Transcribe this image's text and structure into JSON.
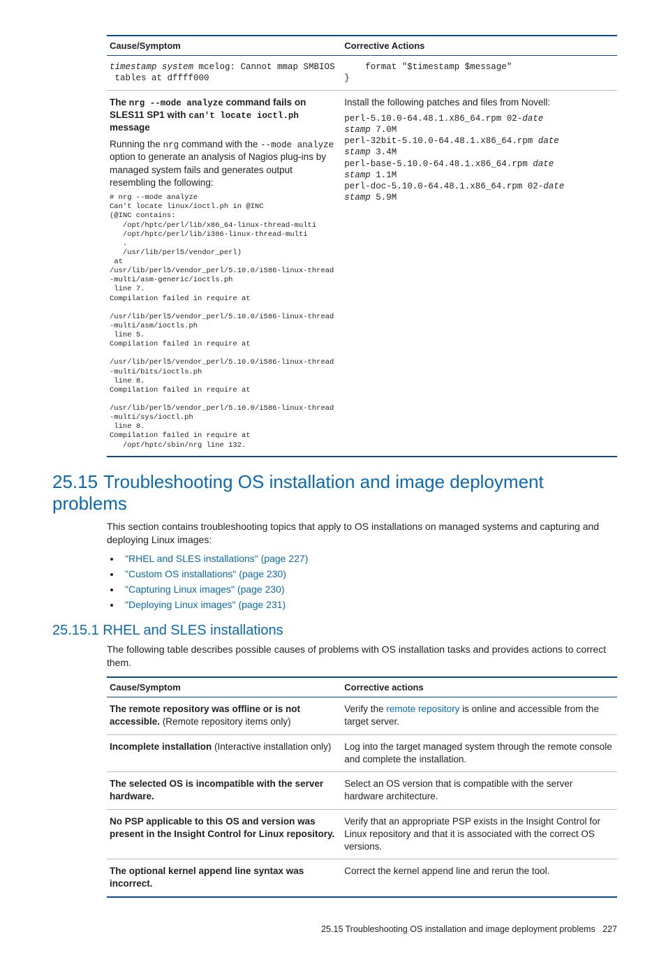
{
  "table1": {
    "headers": {
      "col1": "Cause/Symptom",
      "col2": "Corrective Actions"
    },
    "row1": {
      "symptom_pre": "timestamp system",
      "symptom_rest": " mcelog: Cannot mmap SMBIOS\n tables at dffff000",
      "action": "    format \"$timestamp $message\"\n}"
    },
    "row2": {
      "title_a": "The ",
      "title_cmd1": "nrg --mode analyze",
      "title_b": " command fails on SLES11 SP1 with ",
      "title_cmd2": "can't locate ioctl.ph",
      "title_c": " message",
      "desc_a": "Running the ",
      "desc_cmd1": "nrg",
      "desc_b": " command with the ",
      "desc_cmd2": "--mode analyze",
      "desc_c": " option to generate an analysis of Nagios plug-ins by managed system fails and generates output resembling the following:",
      "code": "# nrg --mode analyze\nCan't locate linux/ioctl.ph in @INC\n(@INC contains:\n   /opt/hptc/perl/lib/x86_64-linux-thread-multi\n   /opt/hptc/perl/lib/i386-linux-thread-multi\n   .\n   /usr/lib/perl5/vendor_perl)\n at\n/usr/lib/perl5/vendor_perl/5.10.0/i586-linux-thread-multi/asm-generic/ioctls.ph\n line 7.\nCompilation failed in require at\n\n/usr/lib/perl5/vendor_perl/5.10.0/i586-linux-thread-multi/asm/ioctls.ph\n line 5.\nCompilation failed in require at\n\n/usr/lib/perl5/vendor_perl/5.10.0/i586-linux-thread-multi/bits/ioctls.ph\n line 8.\nCompilation failed in require at\n\n/usr/lib/perl5/vendor_perl/5.10.0/i586-linux-thread-multi/sys/ioctl.ph\n line 8.\nCompilation failed in require at\n   /opt/hptc/sbin/nrg line 132.",
      "action_intro": "Install the following patches and files from Novell:",
      "action_code": "perl-5.10.0-64.48.1.x86_64.rpm 02-date\nstamp 7.0M\nperl-32bit-5.10.0-64.48.1.x86_64.rpm date\nstamp 3.4M\nperl-base-5.10.0-64.48.1.x86_64.rpm date\nstamp 1.1M\nperl-doc-5.10.0-64.48.1.x86_64.rpm 02-date\nstamp 5.9M"
    }
  },
  "section": {
    "num": "25.15",
    "title": "Troubleshooting OS installation and image deployment problems",
    "intro": "This section contains troubleshooting topics that apply to OS installations on managed systems and capturing and deploying Linux images:",
    "links": {
      "l1": "\"RHEL and SLES installations\" (page 227)",
      "l2": "\"Custom OS installations\" (page 230)",
      "l3": "\"Capturing Linux images\" (page 230)",
      "l4": "\"Deploying Linux images\" (page 231)"
    }
  },
  "subsection": {
    "num": "25.15.1",
    "title": "RHEL and SLES installations",
    "intro": "The following table describes possible causes of problems with OS installation tasks and provides actions to correct them."
  },
  "table2": {
    "headers": {
      "col1": "Cause/Symptom",
      "col2": "Corrective actions"
    },
    "rows": {
      "r1": {
        "s_bold": "The remote repository was offline or is not accessible.",
        "s_rest": " (Remote repository items only)",
        "a_pre": "Verify the ",
        "a_link": "remote repository",
        "a_post": " is online and accessible from the target server."
      },
      "r2": {
        "s_bold": "Incomplete installation",
        "s_rest": "  (Interactive installation only)",
        "a": "Log into the target managed system through the remote console and complete the installation."
      },
      "r3": {
        "s_bold": "The selected OS is incompatible with the server hardware.",
        "a": "Select an OS version that is compatible with the server hardware architecture."
      },
      "r4": {
        "s_bold": "No PSP applicable to this OS and version was present in the Insight Control for Linux repository.",
        "a": "Verify that an appropriate PSP exists in the Insight Control for Linux repository and that it is associated with the correct OS versions."
      },
      "r5": {
        "s_bold": "The optional kernel append line syntax was incorrect.",
        "a": "Correct the kernel append line and rerun the tool."
      }
    }
  },
  "footer": {
    "text": "25.15 Troubleshooting OS installation and image deployment problems",
    "page": "227"
  }
}
